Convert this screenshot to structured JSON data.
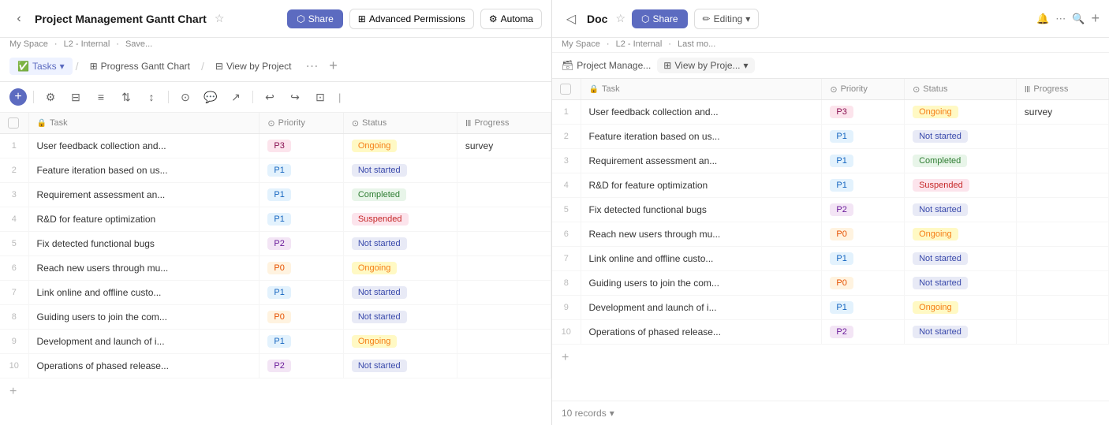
{
  "left": {
    "title": "Project Management Gantt Chart",
    "meta": {
      "space": "My Space",
      "level": "L2 - Internal",
      "save": "Save..."
    },
    "share_label": "Share",
    "adv_permissions_label": "Advanced Permissions",
    "auto_label": "Automa",
    "tabs": [
      {
        "label": "Tasks",
        "icon": "✅",
        "active": true,
        "has_dropdown": true
      },
      {
        "label": "Progress Gantt Chart",
        "icon": "📊"
      },
      {
        "label": "View by Project",
        "icon": "📋"
      }
    ],
    "columns": [
      {
        "label": "",
        "key": "num"
      },
      {
        "label": "Task",
        "key": "task",
        "icon": "🔒"
      },
      {
        "label": "Priority",
        "key": "priority"
      },
      {
        "label": "Status",
        "key": "status"
      },
      {
        "label": "Progress",
        "key": "progress"
      }
    ],
    "rows": [
      {
        "num": 1,
        "task": "User feedback collection and...",
        "priority": "P3",
        "priority_class": "badge-p3",
        "status": "Ongoing",
        "status_class": "badge-ongoing",
        "progress": "survey"
      },
      {
        "num": 2,
        "task": "Feature iteration based on us...",
        "priority": "P1",
        "priority_class": "badge-p1",
        "status": "Not started",
        "status_class": "badge-not-started",
        "progress": ""
      },
      {
        "num": 3,
        "task": "Requirement assessment an...",
        "priority": "P1",
        "priority_class": "badge-p1",
        "status": "Completed",
        "status_class": "badge-completed",
        "progress": ""
      },
      {
        "num": 4,
        "task": "R&D for feature optimization",
        "priority": "P1",
        "priority_class": "badge-p1",
        "status": "Suspended",
        "status_class": "badge-suspended",
        "progress": ""
      },
      {
        "num": 5,
        "task": "Fix detected functional bugs",
        "priority": "P2",
        "priority_class": "badge-p2",
        "status": "Not started",
        "status_class": "badge-not-started",
        "progress": ""
      },
      {
        "num": 6,
        "task": "Reach new users through mu...",
        "priority": "P0",
        "priority_class": "badge-p0",
        "status": "Ongoing",
        "status_class": "badge-ongoing",
        "progress": ""
      },
      {
        "num": 7,
        "task": "Link online and offline custo...",
        "priority": "P1",
        "priority_class": "badge-p1",
        "status": "Not started",
        "status_class": "badge-not-started",
        "progress": ""
      },
      {
        "num": 8,
        "task": "Guiding users to join the com...",
        "priority": "P0",
        "priority_class": "badge-p0",
        "status": "Not started",
        "status_class": "badge-not-started",
        "progress": ""
      },
      {
        "num": 9,
        "task": "Development and launch of i...",
        "priority": "P1",
        "priority_class": "badge-p1",
        "status": "Ongoing",
        "status_class": "badge-ongoing",
        "progress": ""
      },
      {
        "num": 10,
        "task": "Operations of phased release...",
        "priority": "P2",
        "priority_class": "badge-p2",
        "status": "Not started",
        "status_class": "badge-not-started",
        "progress": ""
      }
    ]
  },
  "right": {
    "title": "Doc",
    "meta": {
      "space": "My Space",
      "level": "L2 - Internal",
      "last": "Last mo..."
    },
    "share_label": "Share",
    "editing_label": "Editing",
    "project_view": "Project Manage...",
    "view_by": "View by Proje...",
    "columns": [
      {
        "label": "",
        "key": "num"
      },
      {
        "label": "Task",
        "key": "task",
        "icon": "🔒"
      },
      {
        "label": "Priority",
        "key": "priority"
      },
      {
        "label": "Status",
        "key": "status"
      },
      {
        "label": "Progress",
        "key": "progress"
      }
    ],
    "rows": [
      {
        "num": 1,
        "task": "User feedback collection and...",
        "priority": "P3",
        "priority_class": "badge-p3",
        "status": "Ongoing",
        "status_class": "badge-ongoing",
        "progress": "survey"
      },
      {
        "num": 2,
        "task": "Feature iteration based on us...",
        "priority": "P1",
        "priority_class": "badge-p1",
        "status": "Not started",
        "status_class": "badge-not-started",
        "progress": ""
      },
      {
        "num": 3,
        "task": "Requirement assessment an...",
        "priority": "P1",
        "priority_class": "badge-p1",
        "status": "Completed",
        "status_class": "badge-completed",
        "progress": ""
      },
      {
        "num": 4,
        "task": "R&D for feature optimization",
        "priority": "P1",
        "priority_class": "badge-p1",
        "status": "Suspended",
        "status_class": "badge-suspended",
        "progress": ""
      },
      {
        "num": 5,
        "task": "Fix detected functional bugs",
        "priority": "P2",
        "priority_class": "badge-p2",
        "status": "Not started",
        "status_class": "badge-not-started",
        "progress": ""
      },
      {
        "num": 6,
        "task": "Reach new users through mu...",
        "priority": "P0",
        "priority_class": "badge-p0",
        "status": "Ongoing",
        "status_class": "badge-ongoing",
        "progress": ""
      },
      {
        "num": 7,
        "task": "Link online and offline custo...",
        "priority": "P1",
        "priority_class": "badge-p1",
        "status": "Not started",
        "status_class": "badge-not-started",
        "progress": ""
      },
      {
        "num": 8,
        "task": "Guiding users to join the com...",
        "priority": "P0",
        "priority_class": "badge-p0",
        "status": "Not started",
        "status_class": "badge-not-started",
        "progress": ""
      },
      {
        "num": 9,
        "task": "Development and launch of i...",
        "priority": "P1",
        "priority_class": "badge-p1",
        "status": "Ongoing",
        "status_class": "badge-ongoing",
        "progress": ""
      },
      {
        "num": 10,
        "task": "Operations of phased release...",
        "priority": "P2",
        "priority_class": "badge-p2",
        "status": "Not started",
        "status_class": "badge-not-started",
        "progress": ""
      }
    ],
    "footer": "10 records"
  }
}
